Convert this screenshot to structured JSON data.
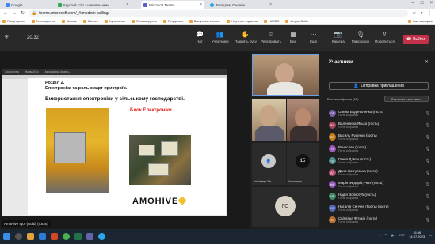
{
  "browser": {
    "tabs": [
      {
        "label": "Google",
        "color": "#4285f4",
        "active": false
      },
      {
        "label": "Круглий стіл з навчальними ...",
        "color": "#34a853",
        "active": false
      },
      {
        "label": "Microsoft Teams",
        "color": "#5b5fc7",
        "active": true
      },
      {
        "label": "Телеграм Онлайн",
        "color": "#2aa3e0",
        "active": false
      }
    ],
    "url": "teams.microsoft.com/_#/modern-calling/",
    "bookmarks": [
      "Популярное",
      "Телевидение",
      "Масаж",
      "Фитнес",
      "Кулинария",
      "Сексоведство",
      "Рецидивы",
      "Вынучные конфиг",
      "Научные издания",
      "НАЗВО",
      "Lingua.Skills",
      "Інші закладки"
    ]
  },
  "teams": {
    "timer": "20:32",
    "toolbar": {
      "chat": "Чат",
      "people": "Участники",
      "raise": "Поднять руку",
      "react": "Реагировать",
      "view": "Вид",
      "more": "Еще",
      "camera": "Камера",
      "mic": "Микрофон",
      "share": "Поделиться",
      "leave": "Выйти"
    },
    "shared_name": "AmoHive Igor (Gold) (гость)",
    "ppt_tabs": [
      "Зоологічна",
      "Назва.Есо",
      "Амофайна_Аналіз..."
    ]
  },
  "slide": {
    "section": "Розділ 2.",
    "subtitle": "Електроніка та роль смарт пристроїв.",
    "heading": "Використання електроніки у сільському господарстві.",
    "block_label": "Блок Електроніки",
    "brand": "AMOHIVE"
  },
  "tiles": {
    "c_name": "Volodymyr Ter...",
    "d_count": "15",
    "d_label": "Участники",
    "e_initials": "ГС"
  },
  "participants": {
    "title": "Участники",
    "invite": "Отправка приглашения",
    "in_meeting": "В этом собрании (15)",
    "mute_all": "Отключить все мик...",
    "list": [
      {
        "initials": "ОВ",
        "name": "Олена Водяноленко (гость)",
        "role": "Гость собрания",
        "color": "#7a5ea8"
      },
      {
        "initials": "ВЯ",
        "name": "Валентина Ясько (гость)",
        "role": "Гость собрания",
        "color": "#a8445e"
      },
      {
        "initials": "ВР",
        "name": "Василь Руденко (гость)",
        "role": "Гость собрания",
        "color": "#c77d1e"
      },
      {
        "initials": "В",
        "name": "Вячеслав (гость)",
        "role": "Гость собрания",
        "color": "#9a5ab8"
      },
      {
        "initials": "ГД",
        "name": "Ганна Дзвон (гость)",
        "role": "Гость собрания",
        "color": "#4c8f8f"
      },
      {
        "initials": "ДЛ",
        "name": "Дина Лозгурська (гость)",
        "role": "Гость собрания",
        "color": "#b0486b"
      },
      {
        "initials": "МФ",
        "name": "Марія Федорів, ЧНУ (гость)",
        "role": "Гость собрания",
        "color": "#8a55b5"
      },
      {
        "initials": "НВ",
        "name": "Надія Волкогуб (гость)",
        "role": "Гость собрания",
        "color": "#3f8a62"
      },
      {
        "initials": "НС",
        "name": "Наталія Сенчин (Гость) (гость)",
        "role": "Гость собрания",
        "color": "#5567b8"
      },
      {
        "initials": "СЧ",
        "name": "Світлана Фітькін (гость)",
        "role": "Гость собрания",
        "color": "#b86f2f"
      }
    ]
  },
  "taskbar": {
    "lang": "УКР",
    "time": "16:56",
    "date": "14.07.2023"
  }
}
